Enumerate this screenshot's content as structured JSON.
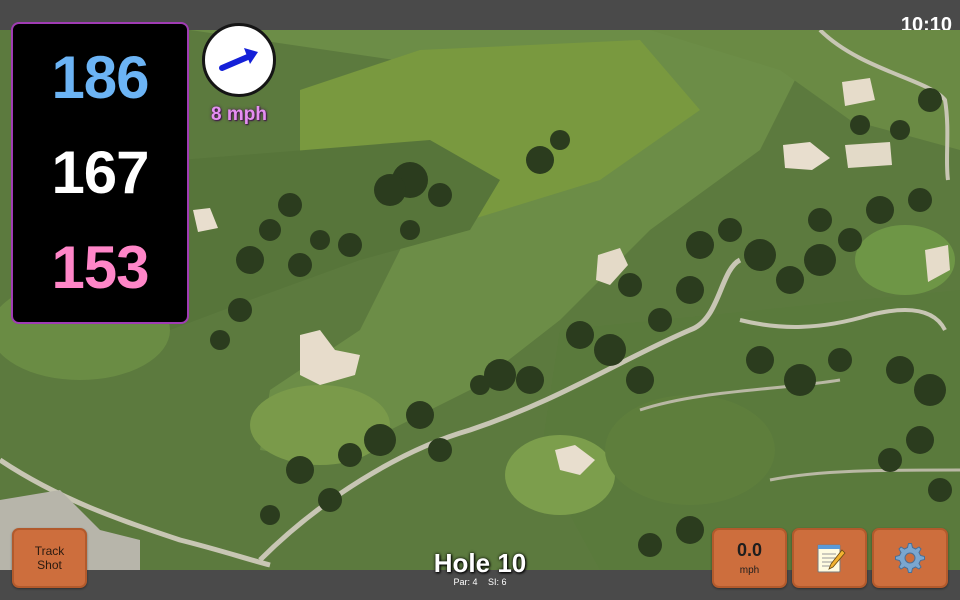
{
  "status_bar": {
    "time": "10:10"
  },
  "distances": {
    "back": "186",
    "middle": "167",
    "front": "153"
  },
  "wind": {
    "speed_label": "8 mph",
    "direction_icon": "arrow-icon"
  },
  "hole": {
    "title": "Hole 10",
    "par_label": "Par: 4",
    "si_label": "SI: 6"
  },
  "buttons": {
    "track_shot_line1": "Track",
    "track_shot_line2": "Shot",
    "speed_value": "0.0",
    "speed_unit": "mph",
    "notes_icon": "notepad-icon",
    "settings_icon": "gear-icon"
  },
  "colors": {
    "back_distance": "#6cb4f5",
    "middle_distance": "#ffffff",
    "front_distance": "#ff86c8",
    "button_fill": "#cd6e3d",
    "panel_border": "#a03cb4"
  }
}
